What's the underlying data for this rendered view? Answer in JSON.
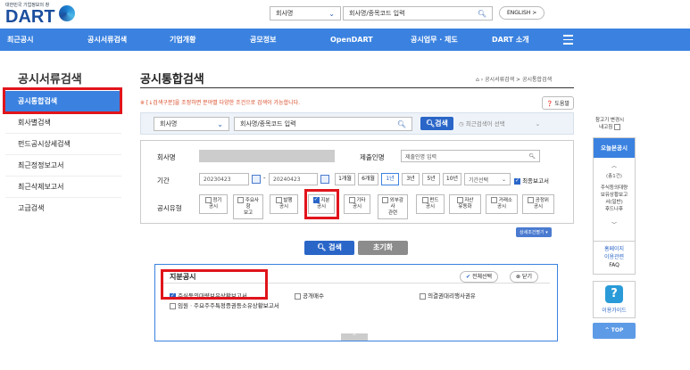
{
  "header": {
    "org": "대한민국 기업정보의 창",
    "logo": "DART",
    "search_select": "회사명",
    "search_placeholder": "회사명/종목코드 입력",
    "english_btn": "ENGLISH >"
  },
  "nav": {
    "items": [
      "최근공시",
      "공시서류검색",
      "기업개황",
      "공모정보",
      "OpenDART",
      "공시업무 · 제도",
      "DART 소개"
    ]
  },
  "left_menu": {
    "title": "공시서류검색",
    "items": [
      "공시통합검색",
      "회사별검색",
      "펀드공시상세검색",
      "최근정정보고서",
      "최근삭제보고서",
      "고급검색"
    ]
  },
  "main": {
    "title": "공시통합검색",
    "breadcrumb": "공시서류검색 > 공시통합검색",
    "notice": "※ [↓검색구분]을 조정하면 분야별 다양한 조건으로 검색이 가능합니다.",
    "help": "도움말",
    "top_select": "회사명",
    "top_input_placeholder": "회사명/종목코드 입력",
    "top_search_btn": "검색",
    "recent_search": "최근검색어 선택",
    "company_label": "회사명",
    "submitter_label": "제출인명",
    "submitter_placeholder": "제출인명 입력",
    "period_label": "기간",
    "date_from": "20230423",
    "date_to": "20240423",
    "period_buttons": [
      "1개월",
      "6개월",
      "1년",
      "3년",
      "5년",
      "10년"
    ],
    "period_select": "기간선택",
    "latest_report": "최종보고서",
    "type_label": "공시유형",
    "types": [
      [
        "정기",
        "공시"
      ],
      [
        "주요사",
        "항",
        "보고"
      ],
      [
        "발행",
        "공시"
      ],
      [
        "지분",
        "공시"
      ],
      [
        "기타",
        "공시"
      ],
      [
        "외부감",
        "사",
        "관련"
      ],
      [
        "펀드",
        "공시"
      ],
      [
        "자산",
        "유동화"
      ],
      [
        "거래소",
        "공시"
      ],
      [
        "공정위",
        "공시"
      ]
    ],
    "detail_btn": "상세조건펼기",
    "search_btn": "검색",
    "reset_btn": "초기화"
  },
  "result_panel": {
    "title": "지분공시",
    "select_all": "전체선택",
    "close": "닫기",
    "items": [
      "주식등의대량보유상황보고서",
      "공개매수",
      "의결권대리행사권유",
      "임원ㆍ주요주주특정증권등소유상황보고서"
    ],
    "up": "^"
  },
  "quick": {
    "title_line1": "참고기 변경시",
    "title_line2": "내고침",
    "box_head": "오늘본공시",
    "count": "(총1건)",
    "item": [
      "주식등의대량",
      "보유상황보고",
      "서(일반)",
      "후드나후"
    ],
    "homepage": [
      "홈페이지",
      "이용관련",
      "FAQ"
    ],
    "guide": "이용가이드",
    "top": "TOP"
  },
  "colors": {
    "nav": "#3b82e0",
    "highlight": "#e1141c",
    "logo": "#1b4e9e"
  }
}
